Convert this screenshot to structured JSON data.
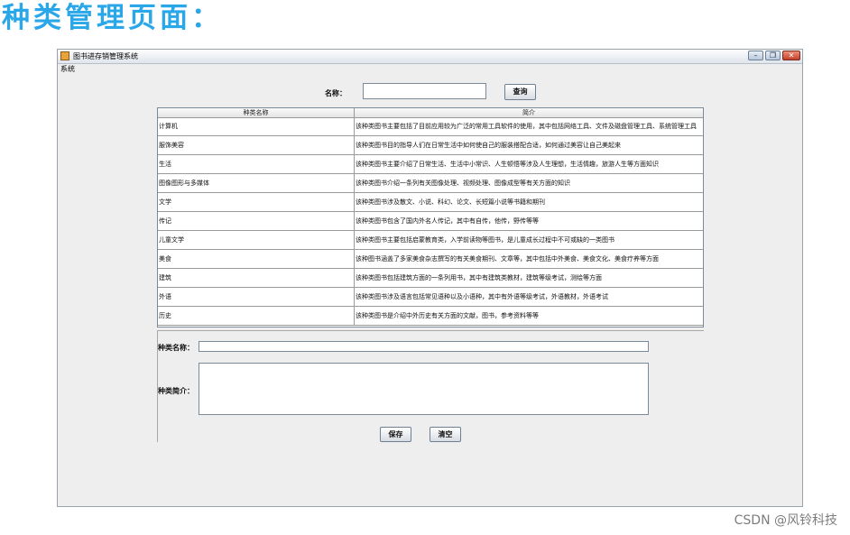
{
  "slide_title": "种类管理页面：",
  "window": {
    "title": "图书进存销管理系统",
    "controls": {
      "minimize": "–",
      "maximize": "❐",
      "close": "✕"
    }
  },
  "menubar": {
    "items": [
      "系统"
    ]
  },
  "search": {
    "label": "名称：",
    "value": "",
    "button": "查询"
  },
  "table": {
    "columns": [
      "种类名称",
      "简介"
    ],
    "rows": [
      [
        "计算机",
        "该种类图书主要包括了目前应用较为广泛的常用工具软件的使用，其中包括网络工具、文件及磁盘管理工具、系统管理工具"
      ],
      [
        "服饰美容",
        "该种类图书目的指导人们在日常生活中如何使自己的服装搭配合适，如何通过美容让自己美起来"
      ],
      [
        "生活",
        "该种类图书主要介绍了日常生活、生活中小常识、人生顿悟等涉及人生理想，生活情趣，旅游人生等方面知识"
      ],
      [
        "图像图形与多媒体",
        "该种类图书介绍一条列有关图像处理、视频处理、图像成型等有关方面的知识"
      ],
      [
        "文学",
        "该种类图书涉及散文、小说、科幻、论文、长短篇小说等书籍和期刊"
      ],
      [
        "传记",
        "该种类图书包含了国内外名人传记，其中有自传，他传，野传等等"
      ],
      [
        "儿童文学",
        "该种类图书主要包括启蒙教育类，入学前读物等图书，是儿童成长过程中不可或缺的一类图书"
      ],
      [
        "美食",
        "该种图书涵盖了多家美食杂志撰写的有关美食期刊、文章等，其中包括中外美食、美食文化、美食疗养等方面"
      ],
      [
        "建筑",
        "该种类图书包括建筑方面的一条列用书，其中有建筑类教材，建筑等级考试，测绘等方面"
      ],
      [
        "外语",
        "该种类图书涉及语言包括常见语种以及小语种，其中有外语等级考试，外语教材，外语考试"
      ],
      [
        "历史",
        "该种类图书是介绍中外历史有关方面的文献，图书，参考资料等等"
      ]
    ]
  },
  "form": {
    "name_label": "种类名称：",
    "name_value": "",
    "desc_label": "种类简介：",
    "desc_value": "",
    "save_button": "保存",
    "clear_button": "清空"
  },
  "watermark": "CSDN @风铃科技"
}
